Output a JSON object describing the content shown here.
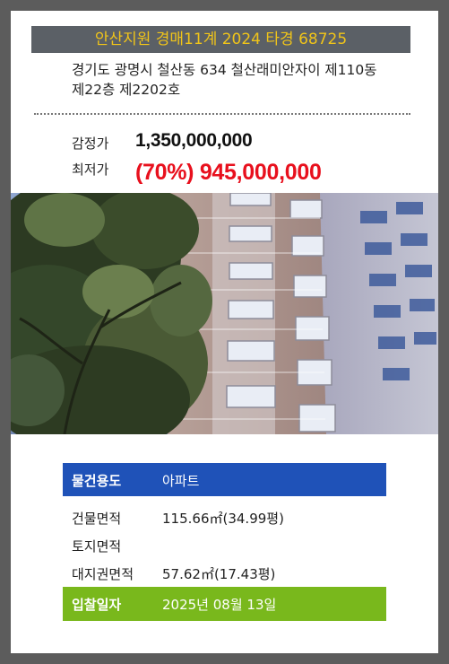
{
  "header": {
    "title": "안산지원 경매11계 2024 타경 68725"
  },
  "address": {
    "line1": "경기도 광명시 철산동 634 철산래미안자이 제110동",
    "line2": "제22층 제2202호"
  },
  "prices": {
    "appraisal_label": "감정가",
    "appraisal_value": "1,350,000,000",
    "minimum_label": "최저가",
    "minimum_value": "(70%) 945,000,000"
  },
  "photo": {
    "subject": "apartment-building"
  },
  "info": {
    "usage_label": "물건용도",
    "usage_value": "아파트",
    "building_area_label": "건물면적",
    "building_area_value": "115.66㎡(34.99평)",
    "land_area_label": "토지면적",
    "land_area_value": "",
    "land_right_area_label": "대지권면적",
    "land_right_area_value": "57.62㎡(17.43평)",
    "bid_date_label": "입찰일자",
    "bid_date_value": "2025년 08월 13일"
  },
  "colors": {
    "background": "#5c5c5c",
    "header_bar": "#5b6066",
    "header_text": "#f0c419",
    "minimum_price": "#e8101d",
    "usage_row": "#1f52b8",
    "bid_row": "#79b81c"
  }
}
